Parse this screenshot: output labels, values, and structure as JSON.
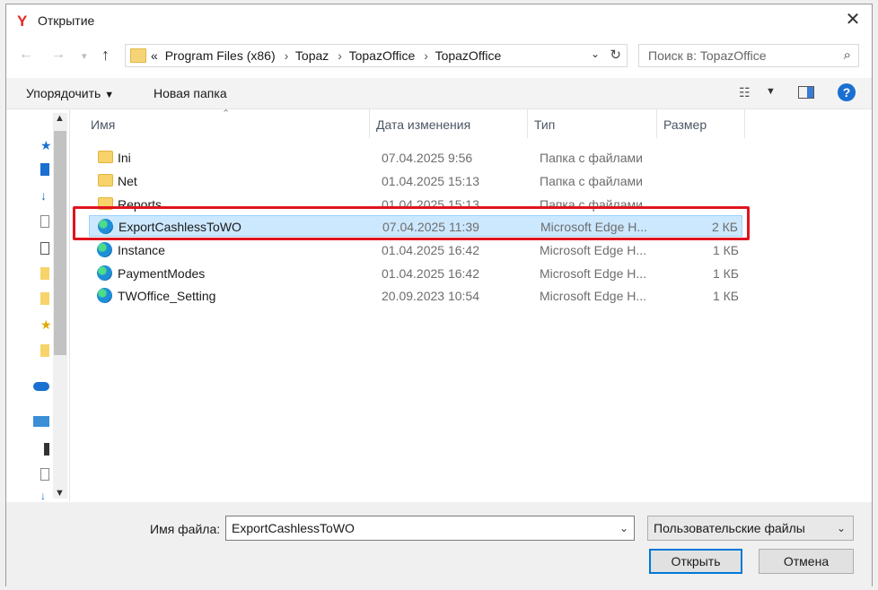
{
  "window": {
    "title": "Открытие",
    "logo": "Y"
  },
  "nav": {
    "back_icon": "arrow-left-icon",
    "forward_icon": "arrow-right-icon",
    "up_icon": "arrow-up-icon",
    "breadcrumb_prefix": "«",
    "breadcrumbs": [
      "Program Files (x86)",
      "Topaz",
      "TopazOffice",
      "TopazOffice"
    ],
    "search_placeholder": "Поиск в: TopazOffice"
  },
  "toolbar": {
    "organize": "Упорядочить",
    "new_folder": "Новая папка"
  },
  "columns": {
    "name": "Имя",
    "date": "Дата изменения",
    "type": "Тип",
    "size": "Размер"
  },
  "files": [
    {
      "name": "Ini",
      "date": "07.04.2025 9:56",
      "type": "Папка с файлами",
      "size": "",
      "icon": "folder-icon"
    },
    {
      "name": "Net",
      "date": "01.04.2025 15:13",
      "type": "Папка с файлами",
      "size": "",
      "icon": "folder-icon"
    },
    {
      "name": "Reports",
      "date": "01.04.2025 15:13",
      "type": "Папка с файлами",
      "size": "",
      "icon": "folder-icon"
    },
    {
      "name": "ExportCashlessToWO",
      "date": "07.04.2025 11:39",
      "type": "Microsoft Edge H...",
      "size": "2 КБ",
      "icon": "edge-icon",
      "selected": true
    },
    {
      "name": "Instance",
      "date": "01.04.2025 16:42",
      "type": "Microsoft Edge H...",
      "size": "1 КБ",
      "icon": "edge-icon"
    },
    {
      "name": "PaymentModes",
      "date": "01.04.2025 16:42",
      "type": "Microsoft Edge H...",
      "size": "1 КБ",
      "icon": "edge-icon"
    },
    {
      "name": "TWOffice_Setting",
      "date": "20.09.2023 10:54",
      "type": "Microsoft Edge H...",
      "size": "1 КБ",
      "icon": "edge-icon"
    }
  ],
  "bottom": {
    "filename_label": "Имя файла:",
    "filename_value": "ExportCashlessToWO",
    "filetype_value": "Пользовательские файлы",
    "open_button": "Открыть",
    "cancel_button": "Отмена"
  },
  "colors": {
    "accent": "#0078d7",
    "highlight": "#e0141e",
    "selection": "#cce8ff"
  }
}
